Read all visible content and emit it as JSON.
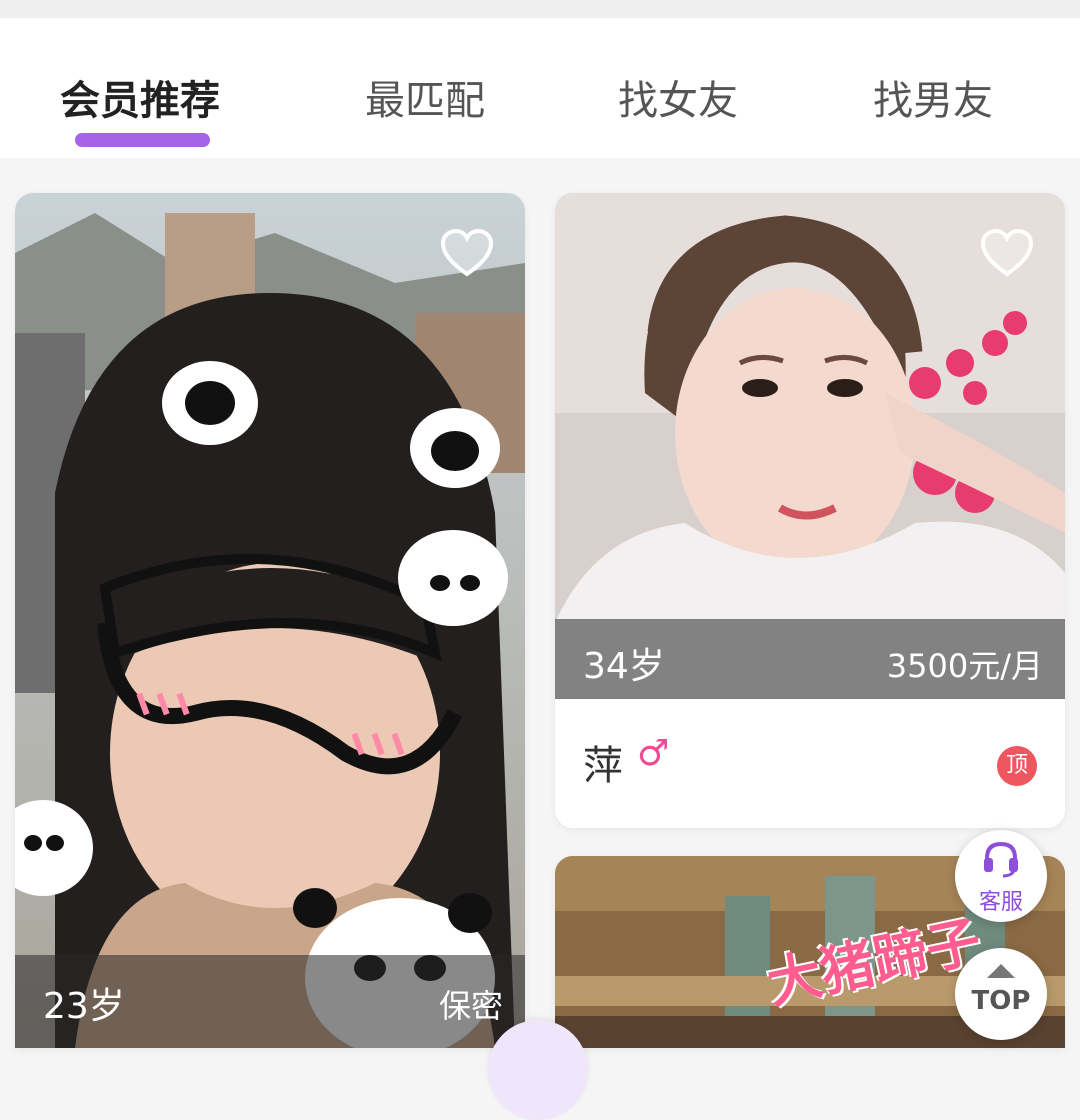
{
  "tabs": [
    {
      "label": "会员推荐",
      "active": true
    },
    {
      "label": "最匹配",
      "active": false
    },
    {
      "label": "找女友",
      "active": false
    },
    {
      "label": "找男友",
      "active": false
    }
  ],
  "cards": [
    {
      "age": "23岁",
      "income": "保密",
      "favorite_icon": "heart-outline-icon"
    },
    {
      "age": "34岁",
      "income": "3500元/月",
      "name": "萍",
      "gender": "♂",
      "badge": "顶",
      "favorite_icon": "heart-outline-icon"
    },
    {
      "banner_text": "大猪蹄子"
    }
  ],
  "floating": {
    "service_label": "客服",
    "service_icon": "headset-icon",
    "top_label": "TOP",
    "top_icon": "up-triangle-icon"
  },
  "colors": {
    "accent": "#a463e8",
    "badge": "#ee5760",
    "gender": "#ef4a92",
    "service": "#8e4fd8"
  }
}
